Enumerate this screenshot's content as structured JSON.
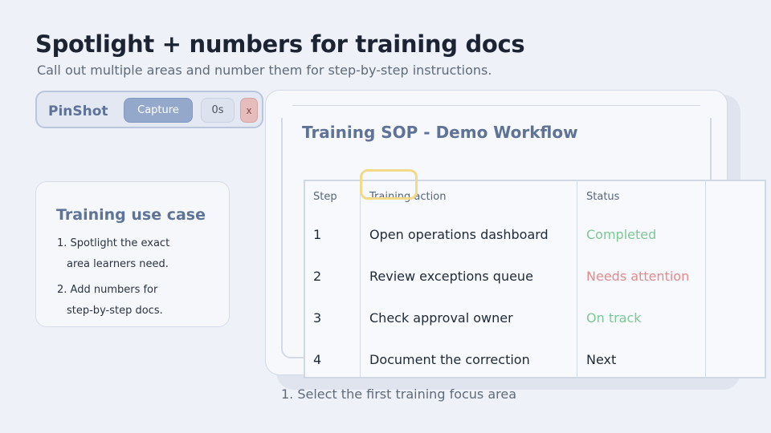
{
  "page": {
    "title": "Spotlight + numbers for training docs",
    "subtitle": "Call out multiple areas and number them for step-by-step instructions."
  },
  "toolbar": {
    "brand": "PinShot",
    "capture_label": "Capture",
    "timer_label": "0s",
    "close_label": "x"
  },
  "usecase": {
    "heading": "Training use case",
    "items": [
      {
        "line1": "1. Spotlight the exact",
        "line2": "area learners need."
      },
      {
        "line1": "2. Add numbers for",
        "line2": "step-by-step docs."
      }
    ]
  },
  "doc": {
    "title": "Training SOP - Demo Workflow",
    "table": {
      "headers": [
        "Step",
        "Training action",
        "Status"
      ],
      "rows": [
        {
          "step": "1",
          "action": "Open operations dashboard",
          "status": "Completed",
          "status_color": "#7ec796"
        },
        {
          "step": "2",
          "action": "Review exceptions queue",
          "status": "Needs attention",
          "status_color": "#e48a8a"
        },
        {
          "step": "3",
          "action": "Check approval owner",
          "status": "On track",
          "status_color": "#7ec796"
        },
        {
          "step": "4",
          "action": "Document the correction",
          "status": "Next",
          "status_color": "#1f2937"
        }
      ]
    }
  },
  "caption": "1. Select the first training focus area",
  "colors": {
    "accent": "#5e7397",
    "focus_ring": "#f3d98a",
    "capture_button": "#94a8cc",
    "close_button": "#e6bcbc"
  }
}
